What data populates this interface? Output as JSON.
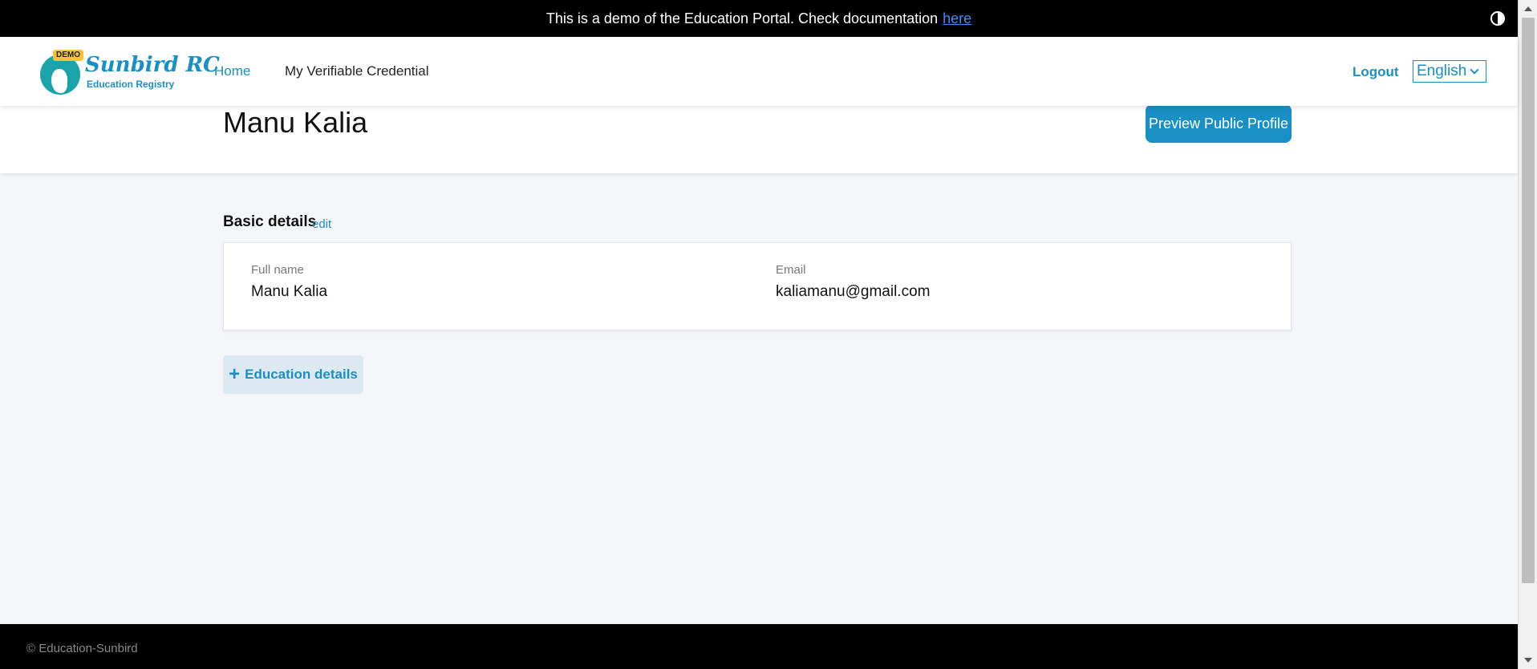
{
  "banner": {
    "text": "This is a demo of the Education Portal. Check documentation",
    "link_label": "here",
    "contrast_icon": "contrast-icon"
  },
  "header": {
    "logo": {
      "badge": "DEMO",
      "title": "Sunbird RC",
      "subtitle": "Education Registry"
    },
    "nav": {
      "home": "Home",
      "verifiable_credential": "My Verifiable Credential"
    },
    "logout": "Logout",
    "language": "English"
  },
  "profile": {
    "name": "Manu Kalia",
    "preview_button": "Preview Public Profile"
  },
  "basic_details": {
    "title": "Basic details",
    "edit": "edit",
    "fields": [
      {
        "label": "Full name",
        "value": "Manu Kalia"
      },
      {
        "label": "Email",
        "value": "kaliamanu@gmail.com"
      }
    ]
  },
  "education": {
    "add_button": "Education details",
    "icon": "plus-icon"
  },
  "footer": {
    "text": "© Education-Sunbird"
  },
  "colors": {
    "accent": "#1a8fc4",
    "banner_bg": "#000000",
    "page_bg": "#f4f6f9"
  }
}
